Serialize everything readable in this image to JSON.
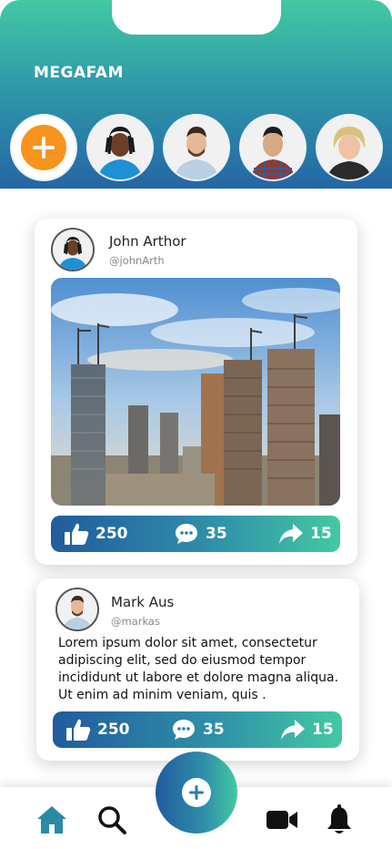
{
  "app": {
    "brand": "MEGAFAM"
  },
  "stories": [
    {
      "type": "add",
      "icon": "plus-icon",
      "color": "#f7941d"
    },
    {
      "type": "avatar",
      "desc": "man with locs, blue shirt"
    },
    {
      "type": "avatar",
      "desc": "man with beard, light shirt"
    },
    {
      "type": "avatar",
      "desc": "man in plaid shirt"
    },
    {
      "type": "avatar",
      "desc": "blonde woman"
    }
  ],
  "posts": [
    {
      "name": "John Arthor",
      "handle": "@johnArth",
      "likes": "250",
      "comments": "35",
      "shares": "15"
    },
    {
      "name": "Mark Aus",
      "handle": "@markas",
      "text": "Lorem ipsum dolor sit amet, consectetur adipiscing elit, sed do eiusmod tempor incididunt ut labore et dolore magna aliqua. Ut enim ad minim veniam, quis .",
      "likes": "250",
      "comments": "35",
      "shares": "15"
    }
  ],
  "nav": {
    "items": [
      "home-icon",
      "search-icon",
      "add-post-button",
      "video-icon",
      "bell-icon"
    ]
  },
  "colors": {
    "header_top": "#43c9a2",
    "header_bottom": "#2466a6",
    "accent": "#f7941d",
    "active_nav": "#2a8aa4"
  }
}
